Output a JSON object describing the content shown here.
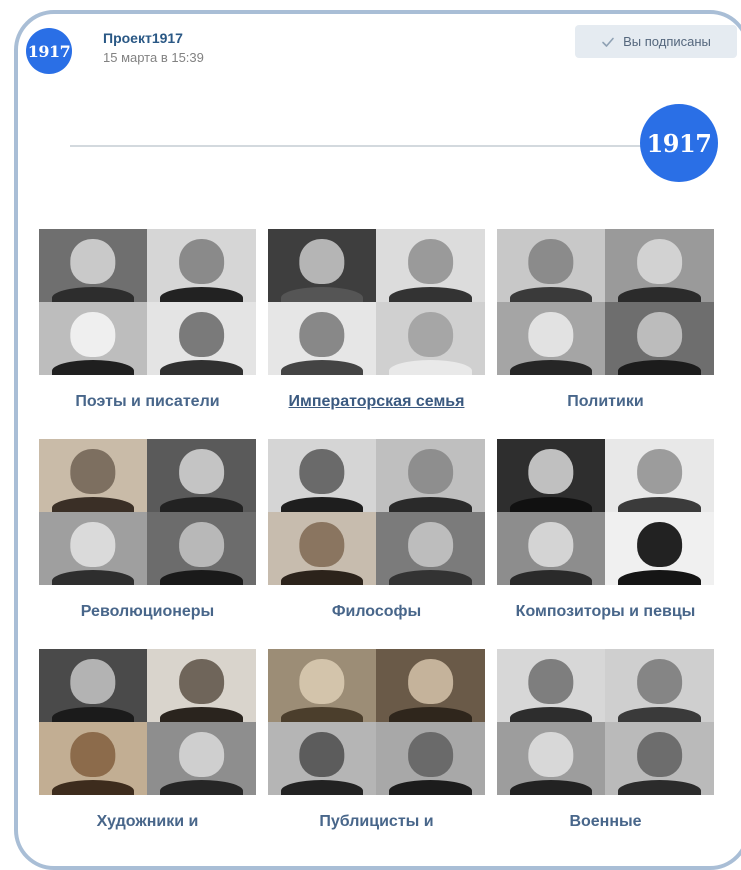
{
  "post": {
    "channel_name": "Проект1917",
    "avatar_text": "1917",
    "timestamp": "15 марта в 15:39",
    "subscribe_label": "Вы подписаны"
  },
  "banner": {
    "logo_text": "1917"
  },
  "categories": [
    {
      "label": "Поэты и писатели"
    },
    {
      "label": "Императорская семья"
    },
    {
      "label": "Политики"
    },
    {
      "label": "Революционеры"
    },
    {
      "label": "Философы"
    },
    {
      "label": "Композиторы и певцы"
    },
    {
      "label": "Художники и"
    },
    {
      "label": "Публицисты и"
    },
    {
      "label": "Военные"
    }
  ],
  "colors": {
    "brand_blue": "#2a6fe6",
    "link_blue": "#2a5885",
    "label_blue": "#48668a",
    "button_bg": "#e5ebf1"
  }
}
